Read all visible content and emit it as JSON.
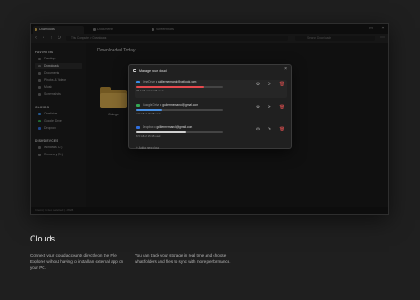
{
  "window": {
    "tabs": [
      {
        "label": "Downloads"
      },
      {
        "label": "Documents"
      },
      {
        "label": "Screenshots"
      }
    ],
    "controls": {
      "minimize": "–",
      "maximize": "□",
      "close": "×"
    },
    "toolbar": {
      "back": "‹",
      "forward": "›",
      "up": "↑",
      "refresh": "↻",
      "address": "This Computer   >   Downloads",
      "search_placeholder": "Search Downloads",
      "menu": "⋯"
    }
  },
  "sidebar": {
    "sections": [
      {
        "title": "FAVORITES",
        "items": [
          "Desktop",
          "Downloads",
          "Documents",
          "Photos & Videos",
          "Music",
          "Screenshots"
        ]
      },
      {
        "title": "CLOUDS",
        "items": [
          "OneDrive",
          "Google Drive",
          "Dropbox"
        ]
      },
      {
        "title": "DISK/DEVICES",
        "items": [
          "Windows (C:)",
          "Recovery (D:)"
        ]
      }
    ],
    "active_item": "Downloads"
  },
  "content": {
    "title": "Downloaded Today",
    "folder_label": "College"
  },
  "statusbar": {
    "text": "3 items   |   1 item selected   |   4.8GB"
  },
  "dialog": {
    "title": "Manage your cloud",
    "close": "×",
    "accounts": [
      {
        "service": "OneDrive",
        "email": "guillermemanol@outlook.com",
        "usage_text": "78.4 GB of 115 GB used",
        "used_fraction": 0.78,
        "color": "#e5484d",
        "icon_color": "#3a8ee6"
      },
      {
        "service": "Google Drive",
        "email": "guillermemanol@gmail.com",
        "usage_text": "4.5 GB of 15 GB used",
        "used_fraction": 0.3,
        "color": "#4a90e2",
        "icon_color": "#34a853"
      },
      {
        "service": "Dropbox",
        "email": "guillermemanol@gmail.com",
        "usage_text": "8.5 GB of 15 GB used",
        "used_fraction": 0.57,
        "color": "#d0d0d0",
        "icon_color": "#2f6fe0"
      }
    ],
    "add_label": "+   Add a new cloud",
    "settings_icon": "⚙",
    "sync_icon": "⟳",
    "delete_icon": "🗑"
  },
  "promo": {
    "heading": "Clouds",
    "para1": "Connect your cloud accounts directly on the File Explorer without having to install an external app on your PC.",
    "para2": "You can track your storage in real time and choose what folders and files to sync with more performance."
  }
}
